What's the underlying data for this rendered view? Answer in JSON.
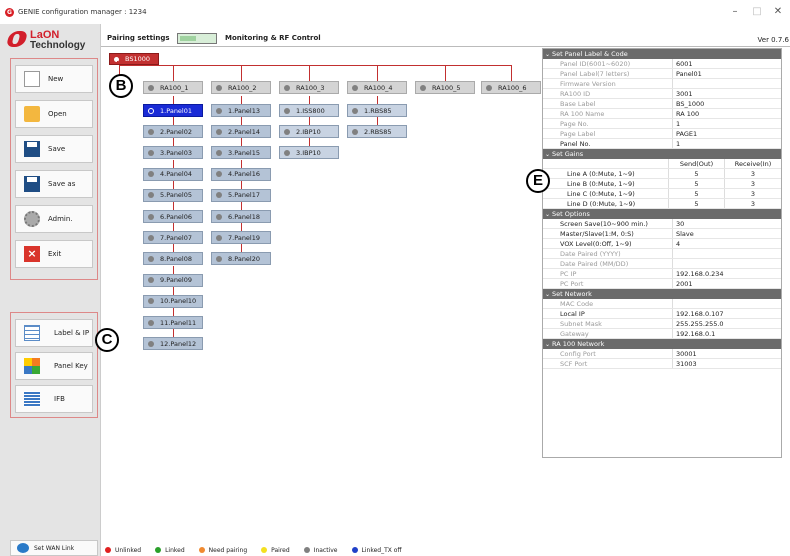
{
  "window": {
    "title": "GENIE configuration manager : 1234",
    "app_icon": "G",
    "minimize": "–",
    "maximize": "□",
    "close": "✕"
  },
  "logo": {
    "line1": "LaON",
    "line2": "Technology"
  },
  "file_buttons": [
    {
      "label": "New",
      "icon": "new-file-icon"
    },
    {
      "label": "Open",
      "icon": "folder-open-icon"
    },
    {
      "label": "Save",
      "icon": "floppy-disk-icon"
    },
    {
      "label": "Save as",
      "icon": "floppy-save-as-icon"
    },
    {
      "label": "Admin.",
      "icon": "gear-icon"
    },
    {
      "label": "Exit",
      "icon": "close-icon"
    }
  ],
  "mode_buttons": [
    {
      "label": "Label & IP",
      "icon": "table-icon"
    },
    {
      "label": "Panel Key",
      "icon": "grid-icon"
    },
    {
      "label": "IFB",
      "icon": "list-icon"
    }
  ],
  "wan_button": "Set WAN Link",
  "toolbar": {
    "pairing": "Pairing settings",
    "monitoring": "Monitoring & RF Control",
    "version": "Ver 0.7.6"
  },
  "tree": {
    "bs": "BS1000",
    "ra": [
      "RA100_1",
      "RA100_2",
      "RA100_3",
      "RA100_4",
      "RA100_5",
      "RA100_6"
    ],
    "columns": [
      [
        "1.Panel01",
        "2.Panel02",
        "3.Panel03",
        "4.Panel04",
        "5.Panel05",
        "6.Panel06",
        "7.Panel07",
        "8.Panel08",
        "9.Panel09",
        "10.Panel10",
        "11.Panel11",
        "12.Panel12"
      ],
      [
        "1.Panel13",
        "2.Panel14",
        "3.Panel15",
        "4.Panel16",
        "5.Panel17",
        "6.Panel18",
        "7.Panel19",
        "8.Panel20"
      ],
      [
        "1.ISS800",
        "2.IBP10",
        "3.IBP10"
      ],
      [
        "1.RBS85",
        "2.RBS85"
      ]
    ]
  },
  "callouts": {
    "b": "B",
    "c": "C",
    "e": "E"
  },
  "legend": [
    {
      "label": "Unlinked",
      "color": "#e02020"
    },
    {
      "label": "Linked",
      "color": "#2aa02a"
    },
    {
      "label": "Need pairing",
      "color": "#f08a30"
    },
    {
      "label": "Paired",
      "color": "#f4e020"
    },
    {
      "label": "Inactive",
      "color": "#808080"
    },
    {
      "label": "Linked_TX off",
      "color": "#2040c8"
    }
  ],
  "props": {
    "s1": "Set Panel Label & Code",
    "r1": [
      {
        "k": "Panel ID(6001~6020)",
        "v": "6001",
        "dis": true
      },
      {
        "k": "Panel Label(7 letters)",
        "v": "Panel01",
        "dis": true
      },
      {
        "k": "Firmware Version",
        "v": "",
        "dis": true
      },
      {
        "k": "RA100 ID",
        "v": "3001",
        "dis": true
      },
      {
        "k": "Base Label",
        "v": "BS_1000",
        "dis": true
      },
      {
        "k": "RA 100 Name",
        "v": "RA 100",
        "dis": true
      },
      {
        "k": "Page No.",
        "v": "1",
        "dis": true
      },
      {
        "k": "Page Label",
        "v": "PAGE1",
        "dis": true
      },
      {
        "k": "Panel No.",
        "v": "1",
        "dis": false
      }
    ],
    "s2": "Set Gains",
    "gain_head": {
      "c1": "Send(Out)",
      "c2": "Receive(In)"
    },
    "gains": [
      {
        "k": "Line A (0:Mute, 1~9)",
        "s": "5",
        "r": "3"
      },
      {
        "k": "Line B (0:Mute, 1~9)",
        "s": "5",
        "r": "3"
      },
      {
        "k": "Line C (0:Mute, 1~9)",
        "s": "5",
        "r": "3"
      },
      {
        "k": "Line D (0:Mute, 1~9)",
        "s": "5",
        "r": "3"
      }
    ],
    "s3": "Set Options",
    "r3": [
      {
        "k": "Screen Save(10~900 min.)",
        "v": "30",
        "dis": false
      },
      {
        "k": "Master/Slave(1:M, 0:S)",
        "v": "Slave",
        "dis": false
      },
      {
        "k": "VOX Level(0:Off, 1~9)",
        "v": "4",
        "dis": false
      },
      {
        "k": "Date Paired (YYYY)",
        "v": "",
        "dis": true
      },
      {
        "k": "Date Paired (MM/DD)",
        "v": "",
        "dis": true
      },
      {
        "k": "PC IP",
        "v": "192.168.0.234",
        "dis": true
      },
      {
        "k": "PC Port",
        "v": "2001",
        "dis": true
      }
    ],
    "s4": "Set Network",
    "r4": [
      {
        "k": "MAC Code",
        "v": "",
        "dis": true
      },
      {
        "k": "Local IP",
        "v": "192.168.0.107",
        "dis": false
      },
      {
        "k": "Subnet Mask",
        "v": "255.255.255.0",
        "dis": true
      },
      {
        "k": "Gateway",
        "v": "192.168.0.1",
        "dis": true
      }
    ],
    "s5": "RA 100 Network",
    "r5": [
      {
        "k": "Config Port",
        "v": "30001",
        "dis": true
      },
      {
        "k": "SCF Port",
        "v": "31003",
        "dis": true
      }
    ]
  }
}
